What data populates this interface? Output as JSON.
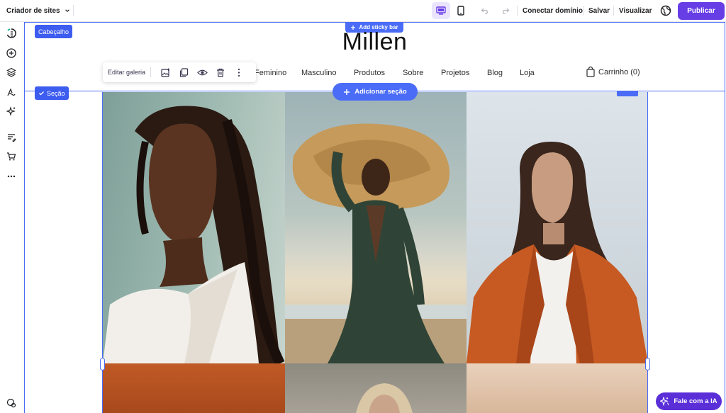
{
  "topbar": {
    "app_title": "Criador de sites",
    "connect_domain": "Conectar domínio",
    "save": "Salvar",
    "preview": "Visualizar",
    "publish": "Publicar"
  },
  "editor": {
    "header_tag": "Cabeçalho",
    "section_tag": "Seção",
    "sticky_bar": "Add sticky bar",
    "add_section": "Adicionar seção",
    "toolbar": {
      "edit_gallery": "Editar galeria"
    },
    "ai_chat": "Fale com a IA"
  },
  "site": {
    "logo": "Millen",
    "nav": [
      "Feminino",
      "Masculino",
      "Produtos",
      "Sobre",
      "Projetos",
      "Blog",
      "Loja"
    ],
    "cart": "Carrinho (0)"
  },
  "colors": {
    "accent": "#673de6",
    "selection": "#4a6cf7",
    "tag": "#3d5cf0"
  },
  "icons": [
    "chevron-down-icon",
    "desktop-icon",
    "mobile-icon",
    "undo-icon",
    "redo-icon",
    "globe-icon",
    "plus-circle-icon",
    "layers-icon",
    "palette-icon",
    "sparkle-icon",
    "pages-icon",
    "cart-icon",
    "more-icon",
    "help-icon",
    "image-icon",
    "duplicate-icon",
    "eye-icon",
    "trash-icon",
    "shopping-bag-icon",
    "check-icon"
  ]
}
